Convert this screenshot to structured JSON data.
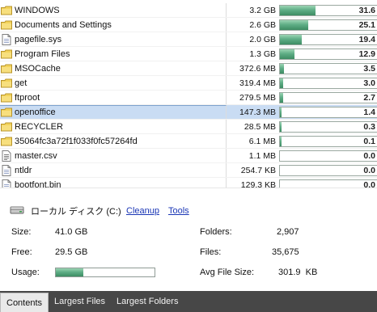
{
  "rows": [
    {
      "name": "WINDOWS",
      "size": "3.2 GB",
      "fill_pct": 31.6,
      "pct_label": "31.6",
      "icon": "folder-icon",
      "selected": false
    },
    {
      "name": "Documents and Settings",
      "size": "2.6 GB",
      "fill_pct": 25.1,
      "pct_label": "25.1",
      "icon": "folder-icon",
      "selected": false
    },
    {
      "name": "pagefile.sys",
      "size": "2.0 GB",
      "fill_pct": 19.4,
      "pct_label": "19.4",
      "icon": "file-icon",
      "selected": false
    },
    {
      "name": "Program Files",
      "size": "1.3 GB",
      "fill_pct": 12.9,
      "pct_label": "12.9",
      "icon": "folder-icon",
      "selected": false
    },
    {
      "name": "MSOCache",
      "size": "372.6 MB",
      "fill_pct": 3.5,
      "pct_label": "3.5",
      "icon": "folder-icon",
      "selected": false
    },
    {
      "name": "get",
      "size": "319.4 MB",
      "fill_pct": 3.0,
      "pct_label": "3.0",
      "icon": "folder-icon",
      "selected": false
    },
    {
      "name": "ftproot",
      "size": "279.5 MB",
      "fill_pct": 2.7,
      "pct_label": "2.7",
      "icon": "folder-icon",
      "selected": false
    },
    {
      "name": "openoffice",
      "size": "147.3 MB",
      "fill_pct": 1.4,
      "pct_label": "1.4",
      "icon": "folder-icon",
      "selected": true
    },
    {
      "name": "RECYCLER",
      "size": "28.5 MB",
      "fill_pct": 0.3,
      "pct_label": "0.3",
      "icon": "folder-icon",
      "selected": false
    },
    {
      "name": "35064fc3a72f1f033f0fc57264fd",
      "size": "6.1 MB",
      "fill_pct": 0.1,
      "pct_label": "0.1",
      "icon": "folder-icon",
      "selected": false
    },
    {
      "name": "master.csv",
      "size": "1.1 MB",
      "fill_pct": 0.0,
      "pct_label": "0.0",
      "icon": "document-icon",
      "selected": false
    },
    {
      "name": "ntldr",
      "size": "254.7 KB",
      "fill_pct": 0.0,
      "pct_label": "0.0",
      "icon": "file-icon",
      "selected": false
    },
    {
      "name": "bootfont.bin",
      "size": "129.3 KB",
      "fill_pct": 0.0,
      "pct_label": "0.0",
      "icon": "file-icon",
      "selected": false
    }
  ],
  "drive": {
    "label": "ローカル ディスク (C:)",
    "cleanup": "Cleanup",
    "tools": "Tools"
  },
  "stats": {
    "size_label": "Size:",
    "size_value": "41.0 GB",
    "free_label": "Free:",
    "free_value": "29.5 GB",
    "usage_label": "Usage:",
    "usage_fraction": 0.28,
    "folders_label": "Folders:",
    "folders_value": "2,907",
    "files_label": "Files:",
    "files_value": "35,675",
    "avg_label": "Avg File Size:",
    "avg_value": "301.9  KB"
  },
  "tabs": [
    {
      "label": "Contents",
      "active": true
    },
    {
      "label": "Largest Files",
      "active": false
    },
    {
      "label": "Largest Folders",
      "active": false
    }
  ],
  "colors": {
    "bar_green": "#5fae86",
    "selection": "#c9dcf3",
    "tab_bar": "#474747",
    "link": "#1a36b5"
  }
}
